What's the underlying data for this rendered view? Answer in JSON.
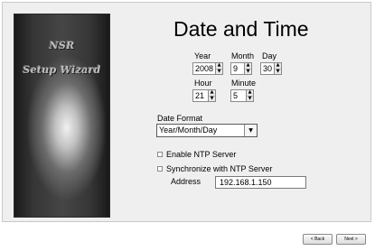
{
  "banner": {
    "line1": "NSR",
    "line2": "Setup Wizard"
  },
  "title": "Date and Time",
  "date": {
    "year_label": "Year",
    "year_value": "2008",
    "month_label": "Month",
    "month_value": "9",
    "day_label": "Day",
    "day_value": "30"
  },
  "time": {
    "hour_label": "Hour",
    "hour_value": "21",
    "minute_label": "Minute",
    "minute_value": "5"
  },
  "date_format": {
    "label": "Date Format",
    "value": "Year/Month/Day"
  },
  "ntp": {
    "enable_label": "Enable NTP Server",
    "enable_checked": false,
    "sync_label": "Synchronize with NTP Server",
    "sync_checked": false,
    "address_label": "Address",
    "address_value": "192.168.1.150"
  },
  "buttons": {
    "back": "< Back",
    "next": "Next >"
  },
  "icons": {
    "spin_up": "up-arrow",
    "spin_down": "down-arrow",
    "dropdown": "chevron-down-icon"
  }
}
